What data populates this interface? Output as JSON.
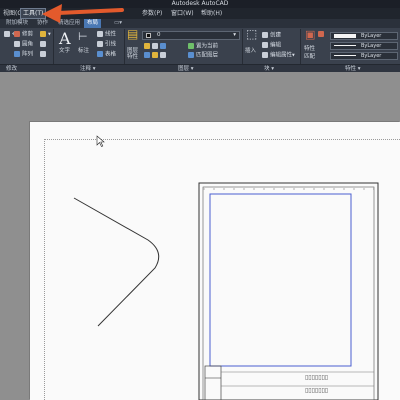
{
  "titlebar": {
    "title": "Autodesk AutoCAD"
  },
  "menubar": {
    "items": [
      {
        "label": "视图(O)",
        "active": false
      },
      {
        "label": "工具(T)",
        "active": true
      },
      {
        "label": "参数(P)",
        "active": false
      },
      {
        "label": "窗口(W)",
        "active": false
      },
      {
        "label": "帮助(H)",
        "active": false
      }
    ]
  },
  "tabs": [
    {
      "label": "附加模块",
      "active": false
    },
    {
      "label": "协作",
      "active": false
    },
    {
      "label": "精选应用",
      "active": false
    },
    {
      "label": "布局",
      "active": true
    }
  ],
  "ribbon": {
    "draw": {
      "items": [
        "修剪",
        "圆角",
        "阵列"
      ]
    },
    "annotation": {
      "text_label": "文字",
      "dim_label": "标注",
      "items": [
        "线性",
        "引线",
        "表格"
      ],
      "panel_title": "注释"
    },
    "layers": {
      "properties_label": "图层特性",
      "current_layer": "0",
      "tools": [
        "置为当前",
        "匹配图层"
      ],
      "panel_title": "图层"
    },
    "block": {
      "insert_label": "插入",
      "tools": [
        "创建",
        "编辑",
        "编辑属性"
      ],
      "panel_title": "块"
    },
    "properties": {
      "props_label": "特性",
      "match_label": "匹配",
      "color": "ByLayer",
      "linetype": "ByLayer",
      "lineweight": "ByLayer",
      "panel_title": "特性"
    },
    "modify_panel_title": "修改"
  },
  "colors": {
    "accent": "#4a78b4",
    "arrow": "#e35a2c",
    "viewport": "#4a5fd0",
    "ribbon_bg": "#3a414d"
  }
}
